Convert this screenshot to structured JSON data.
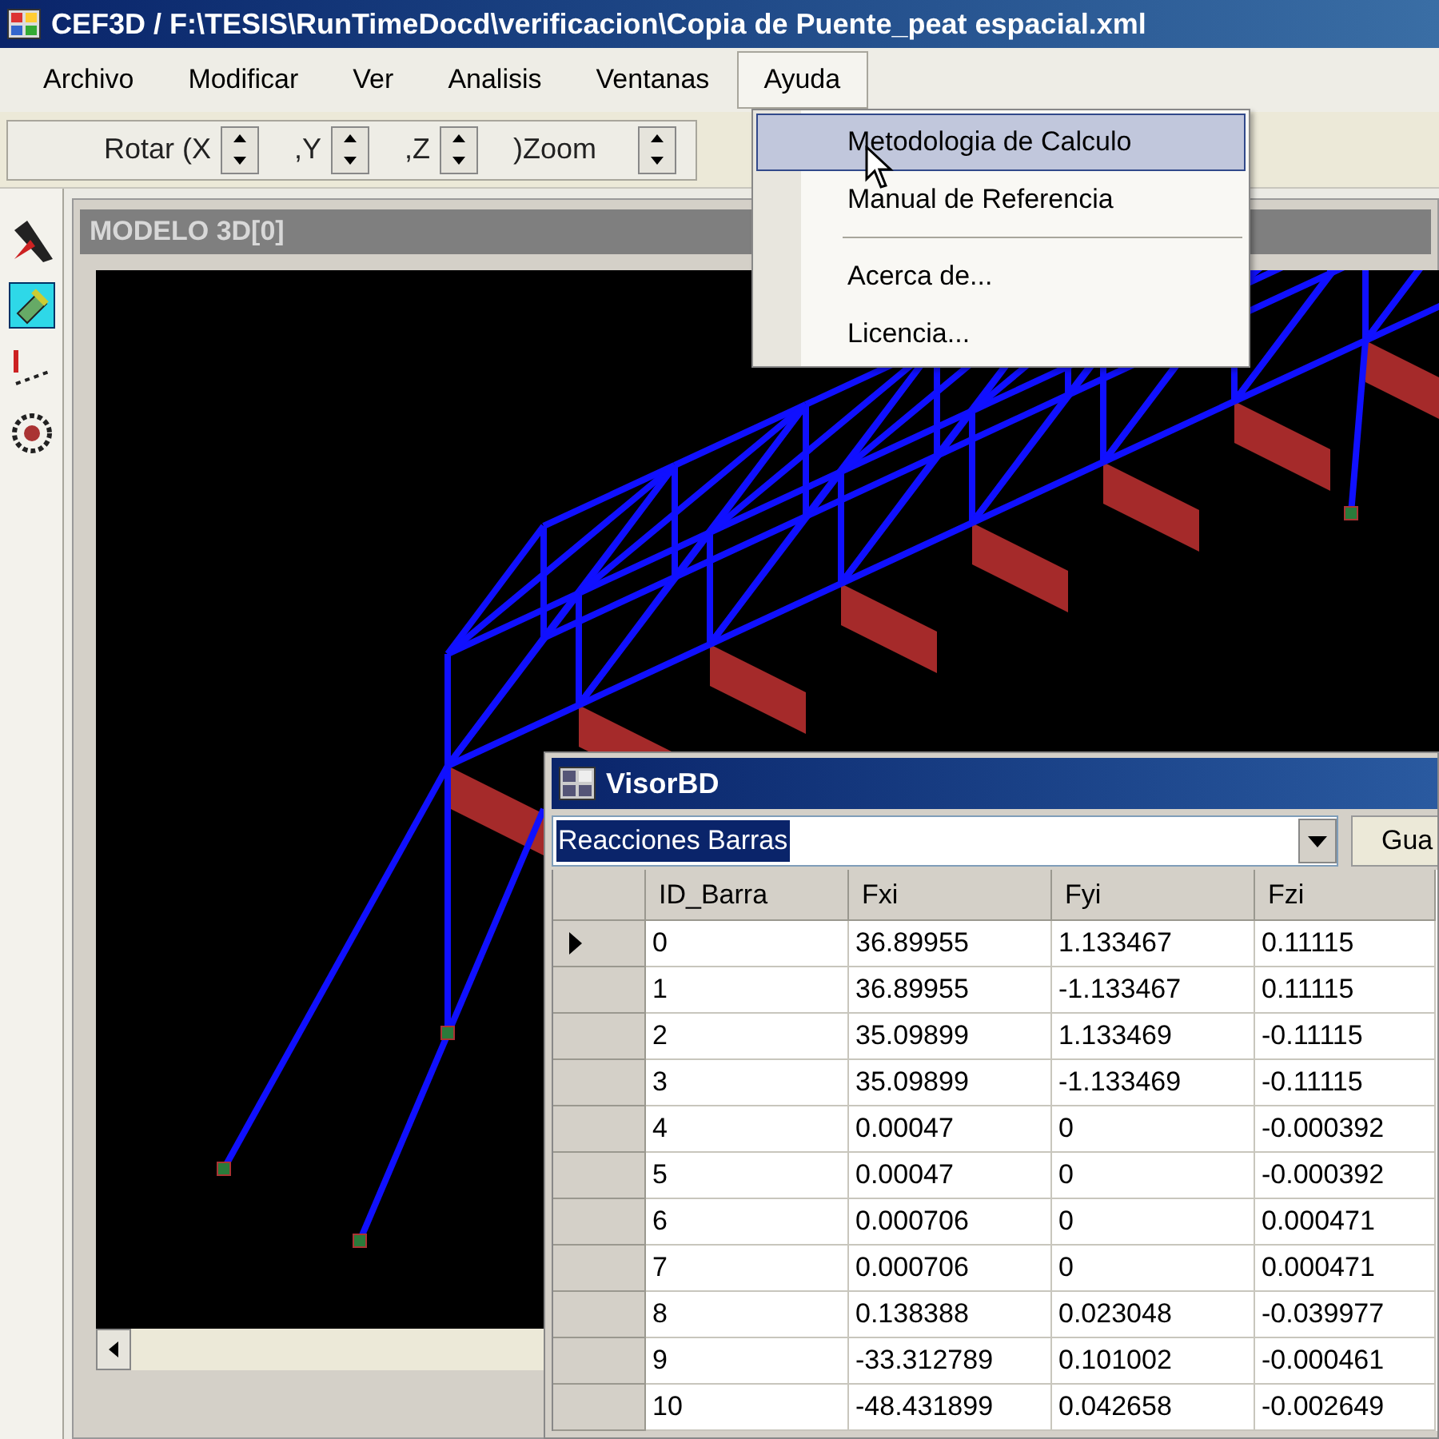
{
  "window": {
    "title": "CEF3D / F:\\TESIS\\RunTimeDocd\\verificacion\\Copia de Puente_peat espacial.xml"
  },
  "menu": [
    {
      "label": "Archivo",
      "open": false
    },
    {
      "label": "Modificar",
      "open": false
    },
    {
      "label": "Ver",
      "open": false
    },
    {
      "label": "Analisis",
      "open": false
    },
    {
      "label": "Ventanas",
      "open": false
    },
    {
      "label": "Ayuda",
      "open": true
    }
  ],
  "help_menu": [
    {
      "kind": "item",
      "label": "Metodologia de Calculo",
      "selected": true
    },
    {
      "kind": "item",
      "label": "Manual de Referencia",
      "selected": false
    },
    {
      "kind": "separator"
    },
    {
      "kind": "item",
      "label": "Acerca de...",
      "selected": false
    },
    {
      "kind": "item",
      "label": "Licencia...",
      "selected": false
    }
  ],
  "toolbar": [
    {
      "label": "Rotar (X"
    },
    {
      "label": ",Y"
    },
    {
      "label": ",Z"
    },
    {
      "label": ")Zoom"
    }
  ],
  "model_window": {
    "title": "MODELO 3D[0]"
  },
  "db_viewer": {
    "title": "VisorBD",
    "query": {
      "value": "Reacciones Barras",
      "text_selected": true
    },
    "button": "Gua",
    "table": {
      "columns": [
        "ID_Barra",
        "Fxi",
        "Fyi",
        "Fzi"
      ],
      "rows": [
        {
          "current": true,
          "cells": [
            "0",
            "36.89955",
            "1.133467",
            "0.11115"
          ]
        },
        {
          "current": false,
          "cells": [
            "1",
            "36.89955",
            "-1.133467",
            "0.11115"
          ]
        },
        {
          "current": false,
          "cells": [
            "2",
            "35.09899",
            "1.133469",
            "-0.11115"
          ]
        },
        {
          "current": false,
          "cells": [
            "3",
            "35.09899",
            "-1.133469",
            "-0.11115"
          ]
        },
        {
          "current": false,
          "cells": [
            "4",
            "0.00047",
            "0",
            "-0.000392"
          ]
        },
        {
          "current": false,
          "cells": [
            "5",
            "0.00047",
            "0",
            "-0.000392"
          ]
        },
        {
          "current": false,
          "cells": [
            "6",
            "0.000706",
            "0",
            "0.000471"
          ]
        },
        {
          "current": false,
          "cells": [
            "7",
            "0.000706",
            "0",
            "0.000471"
          ]
        },
        {
          "current": false,
          "cells": [
            "8",
            "0.138388",
            "0.023048",
            "-0.039977"
          ]
        },
        {
          "current": false,
          "cells": [
            "9",
            "-33.312789",
            "0.101002",
            "-0.000461"
          ]
        },
        {
          "current": false,
          "cells": [
            "10",
            "-48.431899",
            "0.042658",
            "-0.002649"
          ]
        }
      ]
    }
  }
}
